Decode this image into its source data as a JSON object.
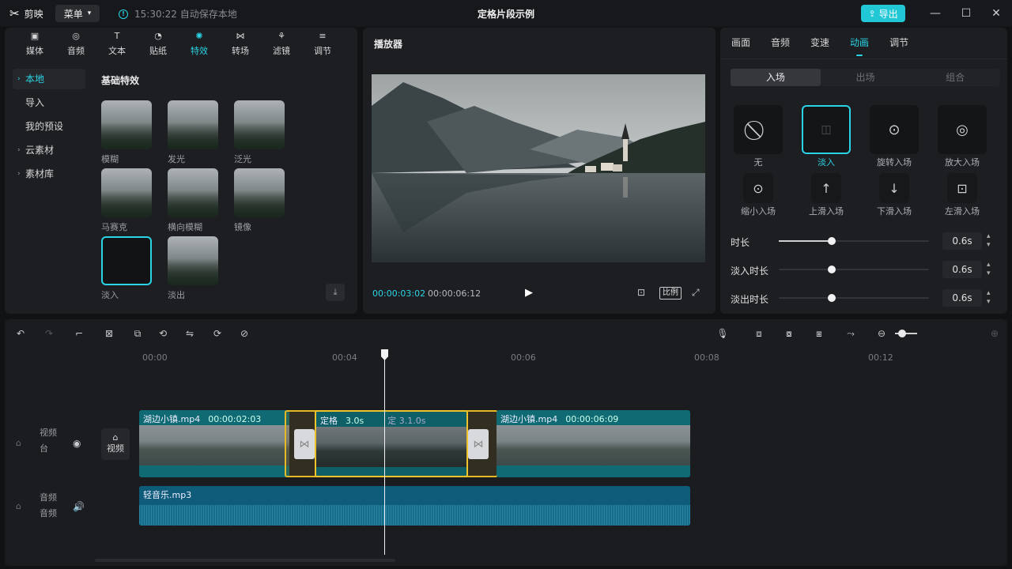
{
  "titlebar": {
    "app_name": "剪映",
    "menu_label": "菜单",
    "save_info": "15:30:22 自动保存本地",
    "title": "定格片段示例",
    "export_label": "导出"
  },
  "media_panel": {
    "tabs": [
      {
        "label": "媒体",
        "icon": "media-icon"
      },
      {
        "label": "音频",
        "icon": "audio-icon"
      },
      {
        "label": "文本",
        "icon": "text-icon"
      },
      {
        "label": "贴纸",
        "icon": "sticker-icon"
      },
      {
        "label": "特效",
        "icon": "effects-icon"
      },
      {
        "label": "转场",
        "icon": "transition-icon"
      },
      {
        "label": "滤镜",
        "icon": "filter-icon"
      },
      {
        "label": "调节",
        "icon": "adjust-icon"
      }
    ],
    "active_tab": "特效",
    "sidebar": [
      {
        "label": "本地",
        "expandable": true,
        "active": true
      },
      {
        "label": "导入",
        "expandable": false,
        "active": false
      },
      {
        "label": "我的预设",
        "expandable": false,
        "active": false
      },
      {
        "label": "云素材",
        "expandable": true,
        "active": false
      },
      {
        "label": "素材库",
        "expandable": true,
        "active": false
      }
    ],
    "section_heading": "基础特效",
    "effects": [
      {
        "label": "模糊"
      },
      {
        "label": "发光"
      },
      {
        "label": "泛光"
      },
      {
        "label": "马赛克"
      },
      {
        "label": "横向模糊"
      },
      {
        "label": "镜像"
      },
      {
        "label": "淡入",
        "selected": true
      },
      {
        "label": "淡出"
      }
    ]
  },
  "player": {
    "title": "播放器",
    "current_time": "00:00:03:02",
    "total_time": "00:00:06:12",
    "ratio_label": "比例"
  },
  "props_panel": {
    "tabs": [
      "画面",
      "音频",
      "变速",
      "动画",
      "调节"
    ],
    "active_tab": "动画",
    "subtabs": [
      "入场",
      "出场",
      "组合"
    ],
    "active_subtab": "入场",
    "animations": [
      {
        "label": "无",
        "icon": "none-icon"
      },
      {
        "label": "淡入",
        "icon": "fade-in-icon",
        "selected": true
      },
      {
        "label": "旋转入场",
        "icon": "rotate-in-icon"
      },
      {
        "label": "放大入场",
        "icon": "zoom-in-icon"
      },
      {
        "label": "缩小入场",
        "icon": "zoom-out-icon"
      },
      {
        "label": "上滑入场",
        "icon": "slide-up-icon"
      },
      {
        "label": "下滑入场",
        "icon": "slide-down-icon"
      },
      {
        "label": "左滑入场",
        "icon": "slide-left-icon"
      }
    ],
    "sliders": [
      {
        "label": "时长",
        "value": "0.6s",
        "level": 0.35
      },
      {
        "label": "淡入时长",
        "value": "0.6s",
        "level": 0.35
      },
      {
        "label": "淡出时长",
        "value": "0.6s",
        "level": 0.35
      }
    ]
  },
  "timeline": {
    "ruler_ticks": [
      "00:00",
      "00:04",
      "00:06",
      "00:08",
      "00:12"
    ],
    "video_track_label": "视频",
    "video_track_sub": "台",
    "cover_label": "视频",
    "audio_track_label": "音频",
    "audio_track_sub": "音频",
    "clips": [
      {
        "name": "湖边小镇.mp4",
        "duration": "00:00:02:03"
      },
      {
        "name": "定格",
        "duration": "3.0s"
      },
      {
        "name": "湖边小镇.mp4",
        "duration": "00:00:06:09"
      }
    ],
    "freeze_ghost_label": "定 3.1.0s",
    "audio_clip": "轻音乐.mp3"
  }
}
